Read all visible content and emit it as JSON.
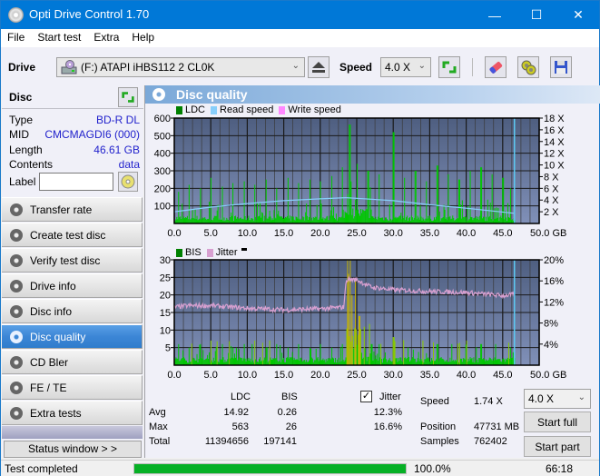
{
  "window": {
    "title": "Opti Drive Control 1.70",
    "controls": {
      "minimize": "—",
      "maximize": "☐",
      "close": "✕"
    }
  },
  "menu": [
    "File",
    "Start test",
    "Extra",
    "Help"
  ],
  "toolbar": {
    "drive_label": "Drive",
    "drive_value": "(F:)  ATAPI iHBS112  2 CL0K",
    "speed_label": "Speed",
    "speed_value": "4.0 X",
    "icons": [
      "drive-icon",
      "eject-icon",
      "refresh-icon",
      "eraser-icon",
      "settings-icon",
      "save-icon"
    ]
  },
  "disc": {
    "header": "Disc",
    "rows": [
      {
        "key": "Type",
        "value": "BD-R DL"
      },
      {
        "key": "MID",
        "value": "CMCMAGDI6 (000)"
      },
      {
        "key": "Length",
        "value": "46.61 GB"
      },
      {
        "key": "Contents",
        "value": "data"
      }
    ],
    "label_key": "Label",
    "label_value": ""
  },
  "nav": [
    {
      "label": "Transfer rate",
      "active": false
    },
    {
      "label": "Create test disc",
      "active": false
    },
    {
      "label": "Verify test disc",
      "active": false
    },
    {
      "label": "Drive info",
      "active": false
    },
    {
      "label": "Disc info",
      "active": false
    },
    {
      "label": "Disc quality",
      "active": true
    },
    {
      "label": "CD Bler",
      "active": false
    },
    {
      "label": "FE / TE",
      "active": false
    },
    {
      "label": "Extra tests",
      "active": false
    }
  ],
  "status_window_button": "Status window > >",
  "panel": {
    "title": "Disc quality"
  },
  "colors": {
    "ldc": "#00c800",
    "ldc_legend": "#008000",
    "read_speed": "#87cefa",
    "write_speed": "#ff88ff",
    "bis": "#00c800",
    "bis_legend": "#008000",
    "jitter": "#d8a0d0",
    "plot_bg_top": "#4e5e80",
    "plot_bg_bottom": "#8090b8",
    "progress": "#06b025",
    "value_text": "#2222cc"
  },
  "chart_data": [
    {
      "type": "bar",
      "title": "LDC / Read speed",
      "legend": [
        "LDC",
        "Read speed",
        "Write speed"
      ],
      "xlabel": "GB",
      "x_ticks": [
        "0.0",
        "5.0",
        "10.0",
        "15.0",
        "20.0",
        "25.0",
        "30.0",
        "35.0",
        "40.0",
        "45.0",
        "50.0 GB"
      ],
      "y_ticks_left": [
        "100",
        "200",
        "300",
        "400",
        "500",
        "600"
      ],
      "y_ticks_right": [
        "2 X",
        "4 X",
        "6 X",
        "8 X",
        "10 X",
        "12 X",
        "14 X",
        "16 X",
        "18 X"
      ],
      "xlim": [
        0,
        50
      ],
      "ylim": [
        0,
        600
      ],
      "y2lim": [
        0,
        18
      ],
      "end_marker_gb": 46.61,
      "series": [
        {
          "name": "LDC (typical peaks)",
          "x": [
            0.5,
            2,
            3.5,
            5,
            6.5,
            8,
            9.5,
            11,
            12.5,
            14,
            15.5,
            17,
            18.5,
            20,
            21.5,
            23,
            24,
            25,
            26.5,
            28,
            30,
            31.5,
            33,
            34.5,
            36,
            37.5,
            39,
            40.5,
            42,
            43.5,
            45,
            46
          ],
          "values": [
            180,
            220,
            200,
            260,
            210,
            230,
            240,
            220,
            250,
            200,
            260,
            230,
            250,
            240,
            270,
            320,
            563,
            340,
            300,
            280,
            520,
            260,
            300,
            240,
            330,
            280,
            250,
            300,
            320,
            280,
            260,
            200
          ]
        },
        {
          "name": "Read speed (X)",
          "x": [
            0,
            5,
            10,
            15,
            20,
            23.5,
            25,
            30,
            35,
            40,
            46.6
          ],
          "values": [
            2.0,
            2.8,
            3.4,
            3.9,
            4.2,
            4.4,
            4.3,
            3.9,
            3.2,
            2.6,
            1.74
          ]
        }
      ]
    },
    {
      "type": "bar",
      "title": "BIS / Jitter",
      "legend": [
        "BIS",
        "Jitter"
      ],
      "xlabel": "GB",
      "x_ticks": [
        "0.0",
        "5.0",
        "10.0",
        "15.0",
        "20.0",
        "25.0",
        "30.0",
        "35.0",
        "40.0",
        "45.0",
        "50.0 GB"
      ],
      "y_ticks_left": [
        "5",
        "10",
        "15",
        "20",
        "25",
        "30"
      ],
      "y_ticks_right": [
        "4%",
        "8%",
        "12%",
        "16%",
        "20%"
      ],
      "xlim": [
        0,
        50
      ],
      "ylim": [
        0,
        30
      ],
      "y2lim": [
        0,
        20
      ],
      "end_marker_gb": 46.61,
      "series": [
        {
          "name": "BIS (typical peaks)",
          "x": [
            0.5,
            2,
            3.5,
            5,
            6.5,
            8,
            9.5,
            11,
            12.5,
            14,
            15.5,
            17,
            18.5,
            20,
            21.5,
            23,
            23.8,
            24.3,
            24.8,
            25.3,
            26,
            27,
            28,
            30,
            32,
            34,
            36,
            38,
            40,
            42,
            44,
            46
          ],
          "values": [
            6,
            5,
            6,
            7,
            6,
            5,
            6,
            7,
            5,
            6,
            5,
            6,
            5,
            6,
            5,
            6,
            26,
            20,
            24,
            14,
            8,
            6,
            6,
            8,
            5,
            7,
            6,
            6,
            7,
            6,
            6,
            5
          ]
        },
        {
          "name": "Jitter (%)",
          "x": [
            0,
            2,
            5,
            10,
            15,
            20,
            23.2,
            23.6,
            25,
            27,
            30,
            35,
            40,
            45,
            46.6
          ],
          "values": [
            11.0,
            11.3,
            11.3,
            10.8,
            10.5,
            10.7,
            11.0,
            16.3,
            16.2,
            14.8,
            14.3,
            14.0,
            13.8,
            13.2,
            13.4
          ]
        }
      ]
    }
  ],
  "stats": {
    "col_ldc": "LDC",
    "col_bis": "BIS",
    "row_avg": "Avg",
    "row_max": "Max",
    "row_total": "Total",
    "ldc_avg": "14.92",
    "ldc_max": "563",
    "ldc_total": "11394656",
    "bis_avg": "0.26",
    "bis_max": "26",
    "bis_total": "197141",
    "jitter_label": "Jitter",
    "jitter_checked": true,
    "jitter_avg": "12.3%",
    "jitter_max": "16.6%",
    "speed_label": "Speed",
    "speed_value": "1.74 X",
    "position_label": "Position",
    "position_value": "47731 MB",
    "samples_label": "Samples",
    "samples_value": "762402",
    "speed_select": "4.0 X",
    "start_full": "Start full",
    "start_part": "Start part"
  },
  "statusbar": {
    "text": "Test completed",
    "progress_percent": 100.0,
    "progress_text": "100.0%",
    "time": "66:18"
  }
}
